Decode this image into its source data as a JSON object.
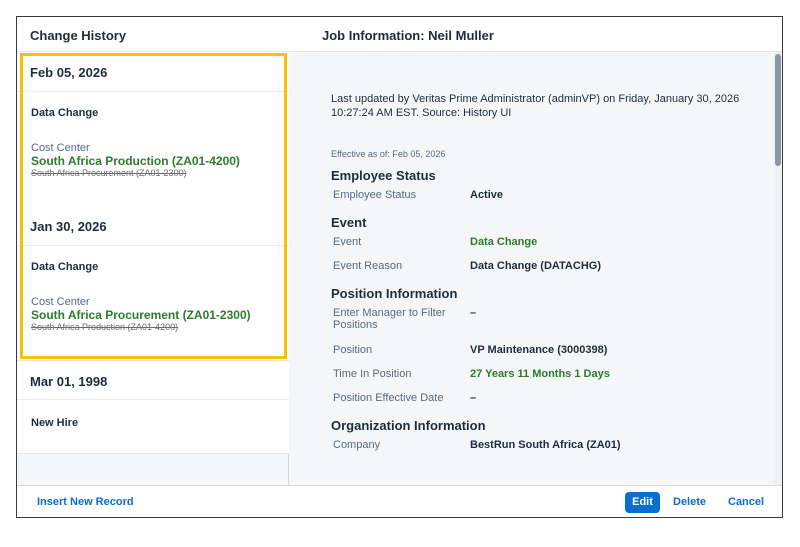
{
  "left": {
    "title": "Change History",
    "entries": [
      {
        "date": "Feb 05, 2026",
        "event": "Data Change",
        "field": "Cost Center",
        "new_value": "South Africa Production (ZA01-4200)",
        "old_value": "South Africa Procurement (ZA01-2300)"
      },
      {
        "date": "Jan 30, 2026",
        "event": "Data Change",
        "field": "Cost Center",
        "new_value": "South Africa Procurement (ZA01-2300)",
        "old_value": "South Africa Production (ZA01-4200)"
      },
      {
        "date": "Mar 01, 1998",
        "event": "New Hire"
      }
    ]
  },
  "right": {
    "title": "Job Information: Neil Muller",
    "updated": "Last updated by Veritas Prime Administrator (adminVP) on Friday, January 30, 2026 10:27:24 AM EST. Source: History UI",
    "effective": "Effective as of: Feb 05, 2026",
    "sections": {
      "employee_status": {
        "title": "Employee Status",
        "rows": [
          {
            "label": "Employee Status",
            "value": "Active"
          }
        ]
      },
      "event": {
        "title": "Event",
        "rows": [
          {
            "label": "Event",
            "value": "Data Change"
          },
          {
            "label": "Event Reason",
            "value": "Data Change (DATACHG)"
          }
        ]
      },
      "position": {
        "title": "Position Information",
        "rows": [
          {
            "label": "Enter Manager to Filter Positions",
            "value": "–"
          },
          {
            "label": "Position",
            "value": "VP Maintenance (3000398)"
          },
          {
            "label": "Time In Position",
            "value": "27 Years 11 Months 1 Days"
          },
          {
            "label": "Position Effective Date",
            "value": "–"
          }
        ]
      },
      "organization": {
        "title": "Organization Information",
        "rows": [
          {
            "label": "Company",
            "value": "BestRun South Africa (ZA01)"
          }
        ]
      }
    }
  },
  "footer": {
    "insert": "Insert New Record",
    "edit": "Edit",
    "delete": "Delete",
    "cancel": "Cancel"
  },
  "colors": {
    "accent": "#0a6ed1",
    "highlight": "#f5c400",
    "positive": "#2b7c2b"
  }
}
